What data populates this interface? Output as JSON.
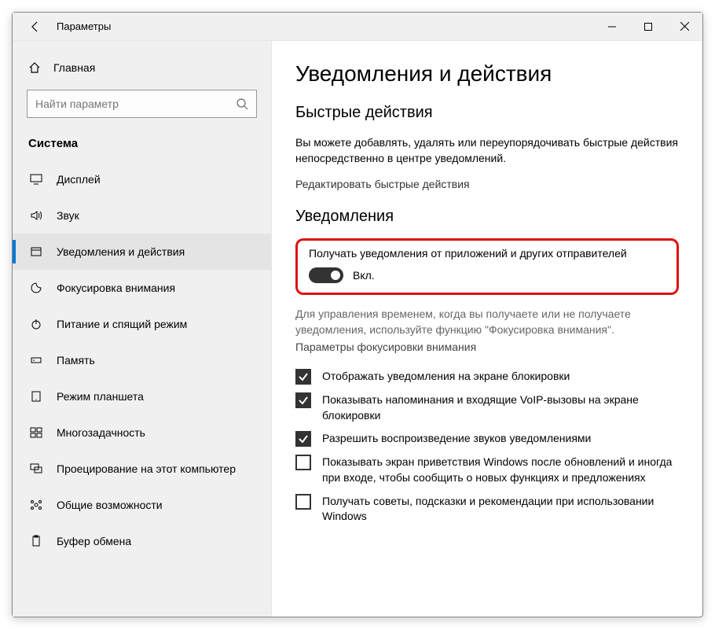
{
  "titlebar": {
    "title": "Параметры"
  },
  "sidebar": {
    "home": "Главная",
    "search_placeholder": "Найти параметр",
    "section": "Система",
    "items": [
      {
        "icon": "display",
        "label": "Дисплей"
      },
      {
        "icon": "sound",
        "label": "Звук"
      },
      {
        "icon": "notify",
        "label": "Уведомления и действия"
      },
      {
        "icon": "focus",
        "label": "Фокусировка внимания"
      },
      {
        "icon": "power",
        "label": "Питание и спящий режим"
      },
      {
        "icon": "storage",
        "label": "Память"
      },
      {
        "icon": "tablet",
        "label": "Режим планшета"
      },
      {
        "icon": "multitask",
        "label": "Многозадачность"
      },
      {
        "icon": "project",
        "label": "Проецирование на этот компьютер"
      },
      {
        "icon": "shared",
        "label": "Общие возможности"
      },
      {
        "icon": "clip",
        "label": "Буфер обмена"
      }
    ]
  },
  "main": {
    "title": "Уведомления и действия",
    "quick_title": "Быстрые действия",
    "quick_desc": "Вы можете добавлять, удалять или переупорядочивать быстрые действия непосредственно в центре уведомлений.",
    "edit_quick": "Редактировать быстрые действия",
    "notif_title": "Уведомления",
    "toggle_label": "Получать уведомления от приложений и других отправителей",
    "toggle_state": "Вкл.",
    "focus_hint1": "Для управления временем, когда вы получаете или не получаете уведомления, используйте функцию \"Фокусировка внимания\".",
    "focus_hint2": "Параметры фокусировки внимания",
    "checks": [
      {
        "checked": true,
        "label": "Отображать уведомления на экране блокировки"
      },
      {
        "checked": true,
        "label": "Показывать напоминания и входящие VoIP-вызовы на экране блокировки"
      },
      {
        "checked": true,
        "label": "Разрешить  воспроизведение звуков уведомлениями"
      },
      {
        "checked": false,
        "label": "Показывать экран приветствия Windows после обновлений и иногда при входе, чтобы сообщить о новых функциях и предложениях"
      },
      {
        "checked": false,
        "label": "Получать советы, подсказки и рекомендации при использовании Windows"
      }
    ]
  }
}
